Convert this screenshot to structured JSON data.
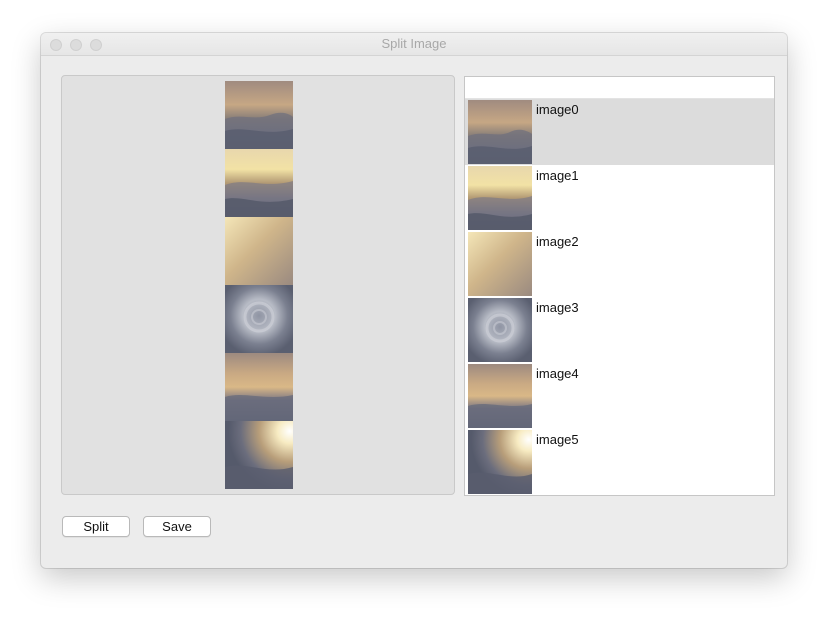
{
  "window": {
    "title": "Split Image"
  },
  "list": {
    "header": "",
    "items": [
      {
        "label": "image0",
        "image": "sky-clouds-1"
      },
      {
        "label": "image1",
        "image": "sunset-clouds"
      },
      {
        "label": "image2",
        "image": "golden-haze"
      },
      {
        "label": "image3",
        "image": "storm-swirl"
      },
      {
        "label": "image4",
        "image": "sky-clouds-2"
      },
      {
        "label": "image5",
        "image": "sun-burst"
      }
    ],
    "selected_index": 0
  },
  "preview": {
    "tiles": [
      "sky-clouds-1",
      "sunset-clouds",
      "golden-haze",
      "storm-swirl",
      "sky-clouds-2",
      "sun-burst"
    ]
  },
  "buttons": {
    "split_label": "Split",
    "save_label": "Save"
  },
  "colors": {
    "window_bg": "#ececec",
    "preview_bg": "#e1e1e1",
    "selection_bg": "#dcdcdc"
  }
}
